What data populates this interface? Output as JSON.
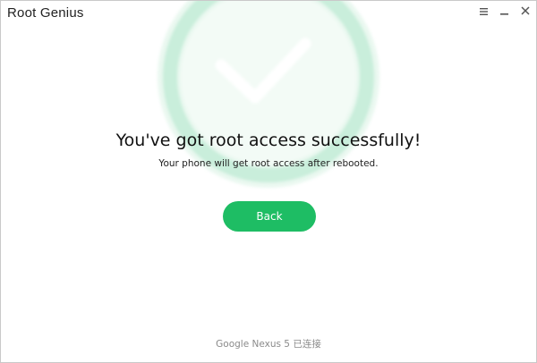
{
  "window": {
    "title": "Root Genius",
    "controls": {
      "menu_icon": "hamburger-menu-icon",
      "minimize_icon": "minimize-icon",
      "close_icon": "close-icon"
    }
  },
  "main": {
    "background_icon": "checkmark-circle-icon",
    "headline": "You've got root access successfully!",
    "subline": "Your phone will get root access after rebooted.",
    "back_button_label": "Back"
  },
  "footer": {
    "device_status": "Google Nexus 5 已连接"
  },
  "colors": {
    "accent_green": "#1ebd64",
    "check_circle_green": "#c9eedb",
    "text_dark": "#111111",
    "text_muted": "#8a8a8a"
  }
}
